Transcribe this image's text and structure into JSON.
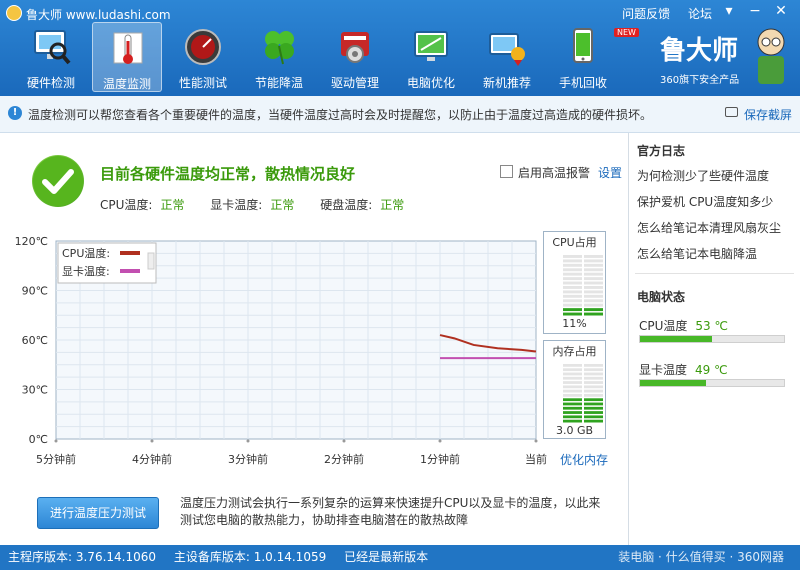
{
  "app": {
    "name": "鲁大师 www.ludashi.com"
  },
  "toplinks": {
    "feedback": "问题反馈",
    "forum": "论坛"
  },
  "nav": {
    "items": [
      {
        "label": "硬件检测",
        "icon": "hardware-monitor-icon"
      },
      {
        "label": "温度监测",
        "icon": "thermometer-icon"
      },
      {
        "label": "性能测试",
        "icon": "speedometer-icon"
      },
      {
        "label": "节能降温",
        "icon": "clover-icon"
      },
      {
        "label": "驱动管理",
        "icon": "driver-gear-icon"
      },
      {
        "label": "电脑优化",
        "icon": "optimize-screen-icon"
      },
      {
        "label": "新机推荐",
        "icon": "new-pc-icon"
      },
      {
        "label": "手机回收",
        "icon": "phone-recycle-icon"
      }
    ],
    "active_index": 1,
    "new_badge": "NEW"
  },
  "brand": {
    "logo_text": "鲁大师",
    "subtitle": "360旗下安全产品"
  },
  "tipbar": {
    "text": "温度检测可以帮您查看各个重要硬件的温度，当硬件温度过高时会及时提醒您，以防止由于温度过高造成的硬件损坏。",
    "save_label": "保存截屏"
  },
  "status": {
    "title": "目前各硬件温度均正常，散热情况良好",
    "cpu_label": "CPU温度:",
    "cpu_status": "正常",
    "gpu_label": "显卡温度:",
    "gpu_status": "正常",
    "disk_label": "硬盘温度:",
    "disk_status": "正常",
    "alarm_label": "启用高温报警",
    "settings_label": "设置"
  },
  "chart_data": {
    "type": "line",
    "y_ticks": [
      "120℃",
      "90℃",
      "60℃",
      "30℃",
      "0℃"
    ],
    "ylim": [
      0,
      120
    ],
    "x_ticks": [
      "5分钟前",
      "4分钟前",
      "3分钟前",
      "2分钟前",
      "1分钟前",
      "当前"
    ],
    "grid": true,
    "legend_position": "top-left",
    "series": [
      {
        "name": "CPU温度:",
        "color": "#b03020",
        "points": [
          [
            4.0,
            63
          ],
          [
            4.15,
            61
          ],
          [
            4.35,
            57
          ],
          [
            4.6,
            55
          ],
          [
            4.85,
            54
          ],
          [
            5.0,
            53
          ]
        ]
      },
      {
        "name": "显卡温度:",
        "color": "#c24fb0",
        "points": [
          [
            4.0,
            49
          ],
          [
            5.0,
            49
          ]
        ]
      }
    ]
  },
  "gauges": {
    "cpu": {
      "title": "CPU占用",
      "value": "11%",
      "fraction": 0.11
    },
    "mem": {
      "title": "内存占用",
      "value": "3.0 GB",
      "fraction": 0.4
    }
  },
  "optimize_memory_label": "优化内存",
  "stress": {
    "button_label": "进行温度压力测试",
    "description": "温度压力测试会执行一系列复杂的运算来快速提升CPU以及显卡的温度，以此来测试您电脑的散热能力，协助排查电脑潜在的散热故障"
  },
  "sidebar": {
    "log_title": "官方日志",
    "links": [
      "为何检测少了些硬件温度",
      "保护爱机 CPU温度知多少",
      "怎么给笔记本清理风扇灰尘",
      "怎么给笔记本电脑降温"
    ],
    "status_title": "电脑状态",
    "cpu_temp_label": "CPU温度",
    "cpu_temp_value": "53 ℃",
    "cpu_temp_fraction": 0.5,
    "gpu_temp_label": "显卡温度",
    "gpu_temp_value": "49 ℃",
    "gpu_temp_fraction": 0.46
  },
  "footer": {
    "main_version": "主程序版本: 3.76.14.1060",
    "db_version": "主设备库版本: 1.0.14.1059",
    "latest": "已经是最新版本",
    "watermark": "装电脑 · 什么值得买 · 360网器"
  }
}
